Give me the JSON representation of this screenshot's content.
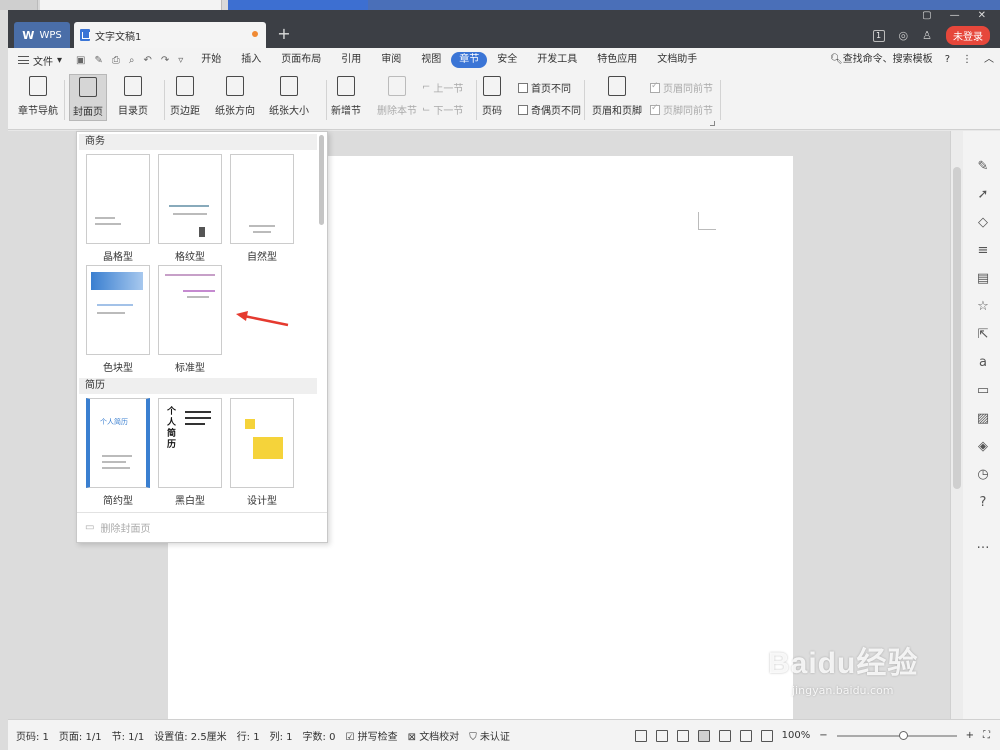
{
  "titlebar": {
    "wps_label": "WPS",
    "doc_title": "文字文稿1",
    "new_tab": "+",
    "counter": "1",
    "login": "未登录"
  },
  "menubar": {
    "file": "文件",
    "items": [
      "开始",
      "插入",
      "页面布局",
      "引用",
      "审阅",
      "视图",
      "章节",
      "安全",
      "开发工具",
      "特色应用",
      "文档助手"
    ],
    "active": "章节",
    "search": "查找命令、搜索模板",
    "help": "?"
  },
  "ribbon": {
    "nav": "章节导航",
    "cover": "封面页",
    "toc": "目录页",
    "margin": "页边距",
    "orientation": "纸张方向",
    "size": "纸张大小",
    "new_section": "新增节",
    "delete_section": "删除本节",
    "prev_section": "上一节",
    "next_section": "下一节",
    "page_number": "页码",
    "first_page_diff": "首页不同",
    "odd_even_diff": "奇偶页不同",
    "header_footer": "页眉和页脚",
    "header_same": "页眉同前节",
    "footer_same": "页脚同前节"
  },
  "dropdown": {
    "section_business": "商务",
    "section_resume": "简历",
    "business_templates": [
      "晶格型",
      "格纹型",
      "自然型",
      "色块型",
      "标准型"
    ],
    "resume_templates": [
      "简约型",
      "黑白型",
      "设计型"
    ],
    "delete_cover": "删除封面页",
    "resume_title1": "个人简历",
    "resume_title2": "个人简历"
  },
  "statusbar": {
    "page_num": "页码: 1",
    "pages": "页面: 1/1",
    "section": "节: 1/1",
    "setting": "设置值: 2.5厘米",
    "row": "行: 1",
    "col": "列: 1",
    "words": "字数: 0",
    "spell": "拼写检查",
    "proof": "文档校对",
    "cert": "未认证",
    "zoom": "100%"
  },
  "watermark": {
    "big": "Baidu经验",
    "small": "jingyan.baidu.com"
  },
  "colors": {
    "accent": "#3b75d6",
    "login": "#e6473b",
    "arrow": "#e53a2f"
  }
}
